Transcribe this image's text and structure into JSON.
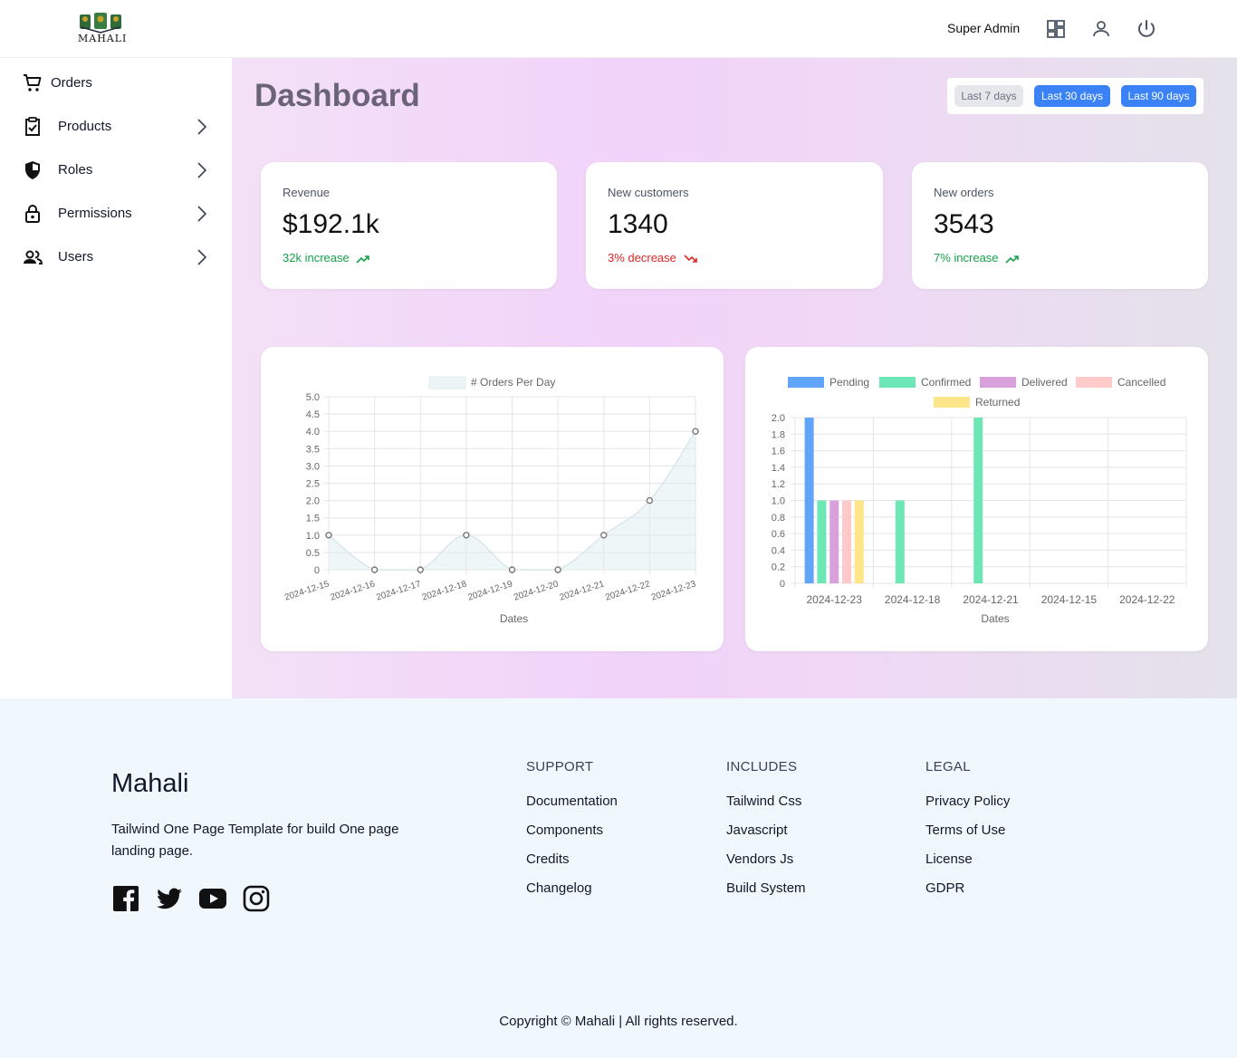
{
  "header": {
    "brand": "MAHALI",
    "user_name": "Super Admin",
    "icons": [
      "dashboard-icon",
      "user-icon",
      "power-icon"
    ]
  },
  "sidebar": {
    "items": [
      {
        "label": "Orders",
        "icon": "cart-icon",
        "expandable": false
      },
      {
        "label": "Products",
        "icon": "clipboard-check-icon",
        "expandable": true
      },
      {
        "label": "Roles",
        "icon": "shield-icon",
        "expandable": true
      },
      {
        "label": "Permissions",
        "icon": "lock-icon",
        "expandable": true
      },
      {
        "label": "Users",
        "icon": "users-icon",
        "expandable": true
      }
    ]
  },
  "main": {
    "title": "Dashboard",
    "ranges": [
      {
        "label": "Last 7 days",
        "active": false
      },
      {
        "label": "Last 30 days",
        "active": true
      },
      {
        "label": "Last 90 days",
        "active": true
      }
    ],
    "stats": [
      {
        "label": "Revenue",
        "value": "$192.1k",
        "delta": "32k increase",
        "trend": "up"
      },
      {
        "label": "New customers",
        "value": "1340",
        "delta": "3% decrease",
        "trend": "down"
      },
      {
        "label": "New orders",
        "value": "3543",
        "delta": "7% increase",
        "trend": "up"
      }
    ]
  },
  "chart_data": [
    {
      "type": "line",
      "x": [
        "2024-12-15",
        "2024-12-16",
        "2024-12-17",
        "2024-12-18",
        "2024-12-19",
        "2024-12-20",
        "2024-12-21",
        "2024-12-22",
        "2024-12-23"
      ],
      "series": [
        {
          "name": "# Orders Per Day",
          "values": [
            1,
            0,
            0,
            1,
            0,
            0,
            1,
            2,
            4
          ]
        }
      ],
      "xlabel": "Dates",
      "ylabel": "",
      "ylim": [
        0,
        5
      ],
      "yticks": [
        "5.0",
        "4.5",
        "4.0",
        "3.5",
        "3.0",
        "2.5",
        "2.0",
        "1.5",
        "1.0",
        "0.5",
        "0"
      ],
      "fill": true,
      "grid": true,
      "legend": "top"
    },
    {
      "type": "bar",
      "categories": [
        "2024-12-23",
        "2024-12-18",
        "2024-12-21",
        "2024-12-15",
        "2024-12-22"
      ],
      "series": [
        {
          "name": "Pending",
          "values": [
            2,
            0,
            0,
            0,
            0
          ],
          "color": "#60a5fa"
        },
        {
          "name": "Confirmed",
          "values": [
            1,
            1,
            2,
            0,
            0
          ],
          "color": "#6ee7b7"
        },
        {
          "name": "Delivered",
          "values": [
            1,
            0,
            0,
            0,
            0
          ],
          "color": "#d8a1dc"
        },
        {
          "name": "Cancelled",
          "values": [
            1,
            0,
            0,
            0,
            0
          ],
          "color": "#fecaca"
        },
        {
          "name": "Returned",
          "values": [
            1,
            0,
            0,
            0,
            0
          ],
          "color": "#fde68a"
        }
      ],
      "xlabel": "Dates",
      "ylabel": "",
      "ylim": [
        0,
        2
      ],
      "yticks": [
        "2.0",
        "1.8",
        "1.6",
        "1.4",
        "1.2",
        "1.0",
        "0.8",
        "0.6",
        "0.4",
        "0.2",
        "0"
      ],
      "grid": true,
      "legend": "top"
    }
  ],
  "footer": {
    "brand": "Mahali",
    "description": "Tailwind One Page Template for build One page landing page.",
    "social": [
      "facebook-icon",
      "twitter-icon",
      "youtube-icon",
      "instagram-icon"
    ],
    "columns": [
      {
        "title": "SUPPORT",
        "links": [
          "Documentation",
          "Components",
          "Credits",
          "Changelog"
        ]
      },
      {
        "title": "INCLUDES",
        "links": [
          "Tailwind Css",
          "Javascript",
          "Vendors Js",
          "Build System"
        ]
      },
      {
        "title": "LEGAL",
        "links": [
          "Privacy Policy",
          "Terms of Use",
          "License",
          "GDPR"
        ]
      }
    ],
    "copyright": "Copyright © Mahali | All rights reserved."
  },
  "colors": {
    "accent": "#3b82f6",
    "increase": "#16a34a",
    "decrease": "#dc2626"
  }
}
